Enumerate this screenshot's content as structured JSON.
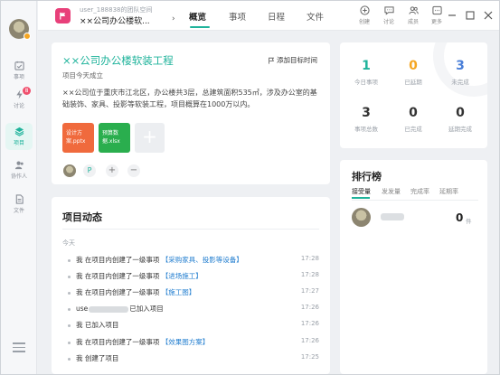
{
  "window": {
    "workspace": "user_188838的团队空间",
    "project_name": "××公司办公楼软...",
    "tabs": [
      "概览",
      "事项",
      "日程",
      "文件"
    ],
    "tools": [
      {
        "icon": "plus-circle-icon",
        "label": "创建"
      },
      {
        "icon": "chat-icon",
        "label": "讨论"
      },
      {
        "icon": "members-icon",
        "label": "成员"
      },
      {
        "icon": "more-icon",
        "label": "更多"
      }
    ]
  },
  "rail": {
    "items": [
      {
        "icon": "calendar-check-icon",
        "label": "事项"
      },
      {
        "icon": "lightning-icon",
        "label": "讨论",
        "badge": "8"
      },
      {
        "icon": "layers-icon",
        "label": "项目"
      },
      {
        "icon": "people-icon",
        "label": "协作人"
      },
      {
        "icon": "file-icon",
        "label": "文件"
      }
    ]
  },
  "project": {
    "title": "××公司办公楼软装工程",
    "add_date_label": "添加目标时间",
    "subtitle": "项目今天成立",
    "description": "××公司位于重庆市江北区，办公楼共3层，总建筑面积535㎡，涉及办公室的基础装饰、家具、投影等软装工程，项目概算在1000万以内。",
    "files": [
      {
        "type": "ppt",
        "label": "设计方案.pptx"
      },
      {
        "type": "xls",
        "label": "预算数据.xlsx"
      }
    ],
    "add_file_label": "+"
  },
  "feed": {
    "title": "项目动态",
    "day": "今天",
    "items": [
      {
        "prefix": "我 在项目内创建了一级事项 ",
        "link": "【采购家具、投影等设备】",
        "time": "17:28"
      },
      {
        "prefix": "我 在项目内创建了一级事项 ",
        "link": "【进场施工】",
        "time": "17:28"
      },
      {
        "prefix": "我 在项目内创建了一级事项 ",
        "link": "【施工图】",
        "time": "17:27"
      },
      {
        "prefix": "use",
        "suffix": "已加入项目",
        "time": "17:26"
      },
      {
        "prefix": "我 已加入项目",
        "time": "17:26"
      },
      {
        "prefix": "我 在项目内创建了一级事项 ",
        "link": "【效果图方案】",
        "time": "17:26"
      },
      {
        "prefix": "我 创建了项目",
        "time": "17:25"
      }
    ]
  },
  "stats": [
    {
      "value": "1",
      "label": "今日事项",
      "color": "#1fb39b"
    },
    {
      "value": "0",
      "label": "已延期",
      "color": "#f5a623"
    },
    {
      "value": "3",
      "label": "未完成",
      "color": "#4a7fd8"
    },
    {
      "value": "3",
      "label": "事项总数",
      "color": "#333333"
    },
    {
      "value": "0",
      "label": "已完成",
      "color": "#333333"
    },
    {
      "value": "0",
      "label": "延期完成",
      "color": "#333333"
    }
  ],
  "ranking": {
    "title": "排行榜",
    "tabs": [
      "接受量",
      "发发量",
      "完成率",
      "延期率"
    ],
    "entry": {
      "value": "0",
      "unit": "件"
    }
  },
  "colors": {
    "accent": "#1fb39b",
    "link": "#1f7ccf",
    "badge": "#f0506e"
  }
}
